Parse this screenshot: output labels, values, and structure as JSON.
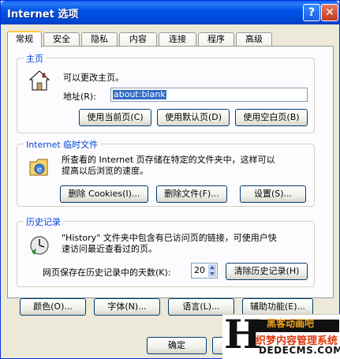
{
  "window": {
    "title": "Internet 选项",
    "help_glyph": "?",
    "close_glyph": "✕"
  },
  "tabs": [
    {
      "label": "常规",
      "active": true
    },
    {
      "label": "安全"
    },
    {
      "label": "隐私"
    },
    {
      "label": "内容"
    },
    {
      "label": "连接"
    },
    {
      "label": "程序"
    },
    {
      "label": "高级"
    }
  ],
  "homepage": {
    "group_title": "主页",
    "description": "可以更改主页。",
    "address_label": "地址(R):",
    "address_value": "about:blank",
    "buttons": {
      "use_current": "使用当前页(C)",
      "use_default": "使用默认页(D)",
      "use_blank": "使用空白页(B)"
    }
  },
  "temp_files": {
    "group_title": "Internet 临时文件",
    "description_line1": "所查看的 Internet 页存储在特定的文件夹中，这样可以",
    "description_line2": "提高以后浏览的速度。",
    "buttons": {
      "delete_cookies": "删除 Cookies(I)...",
      "delete_files": "删除文件(F)...",
      "settings": "设置(S)..."
    }
  },
  "history": {
    "group_title": "历史记录",
    "description_line1": "\"History\" 文件夹中包含有已访问页的链接，可使用户快",
    "description_line2": "速访问最近查看过的页。",
    "days_label": "网页保存在历史记录中的天数(K):",
    "days_value": "20",
    "clear_button": "清除历史记录(H)"
  },
  "bottom_buttons": {
    "colors": "颜色(O)...",
    "fonts": "字体(N)...",
    "languages": "语言(L)...",
    "accessibility": "辅助功能(E)..."
  },
  "dialog_buttons": {
    "ok": "确定"
  },
  "watermark": {
    "letter": "H",
    "line1": "织梦内容管理系统",
    "line2": "DEDECMS.COM",
    "line_top": "黑客动画吧"
  }
}
